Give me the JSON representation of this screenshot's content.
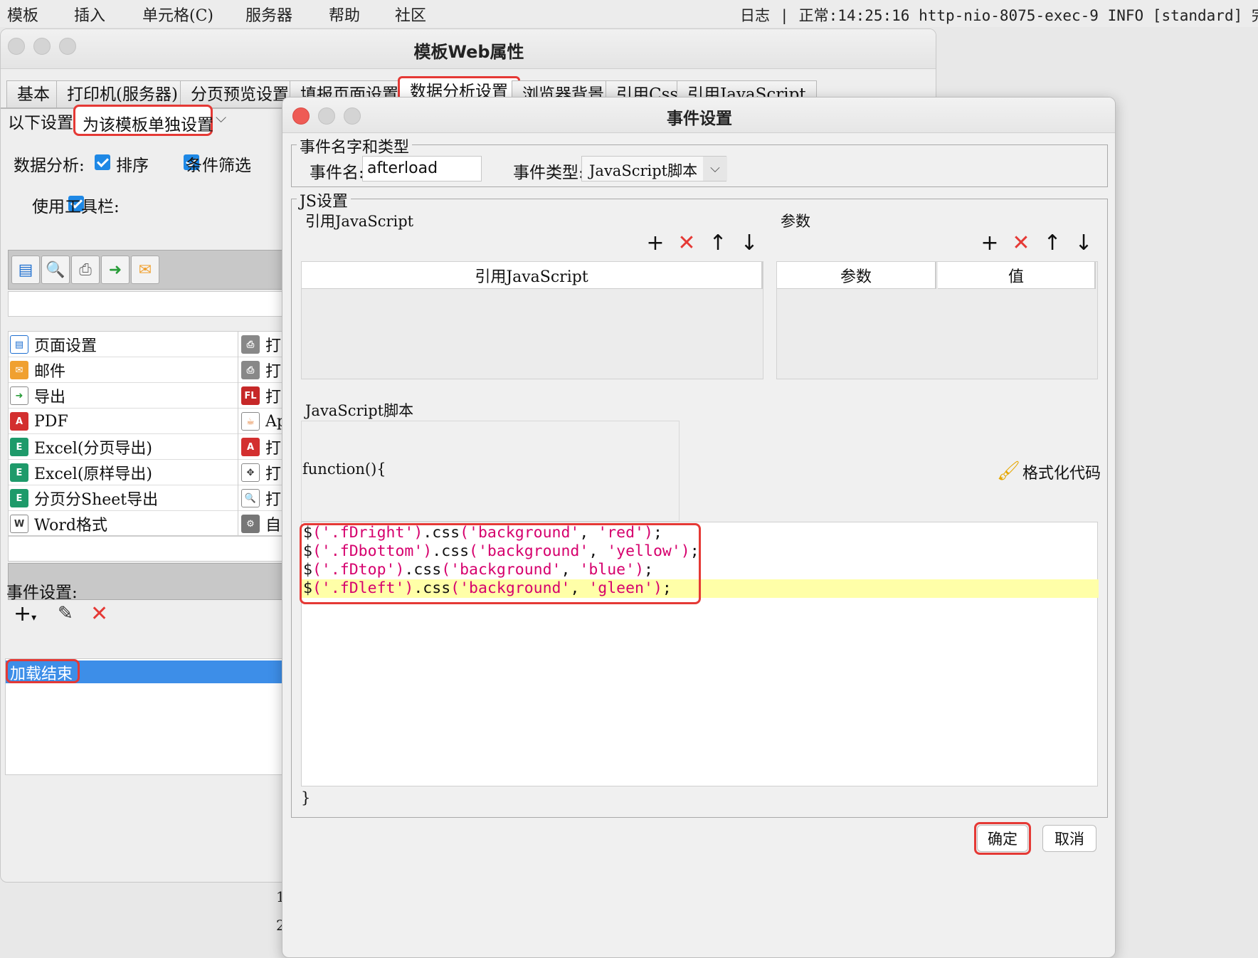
{
  "menubar": {
    "items": [
      "模板",
      "插入",
      "单元格(C)",
      "服务器",
      "帮助",
      "社区"
    ],
    "log_label": "日志",
    "log_text": "正常:14:25:16 http-nio-8075-exec-9 INFO [standard] 完成"
  },
  "background_rows": [
    "1",
    "2"
  ],
  "parent_window": {
    "title": "模板Web属性",
    "tabs": [
      "基本",
      "打印机(服务器)",
      "分页预览设置",
      "填报页面设置",
      "数据分析设置",
      "浏览器背景",
      "引用Css",
      "引用JavaScript"
    ],
    "active_tab": "数据分析设置",
    "settings_label": "以下设置:",
    "settings_value": "为该模板单独设置",
    "analysis_label": "数据分析:",
    "sort_label": "排序",
    "filter_label": "条件筛选",
    "toolbar_label": "使用工具栏:",
    "list_left": [
      "页面设置",
      "邮件",
      "导出",
      "PDF",
      "Excel(分页导出)",
      "Excel(原样导出)",
      "分页分Sheet导出",
      "Word格式"
    ],
    "list_right": [
      "打印",
      "打印",
      "打印",
      "App",
      "打印",
      "打印",
      "打印",
      "自定"
    ],
    "event_label": "事件设置:",
    "event_item": "加载结束"
  },
  "dialog": {
    "title": "事件设置",
    "group_name_type": "事件名字和类型",
    "event_name_label": "事件名:",
    "event_name_value": "afterload",
    "event_type_label": "事件类型:",
    "event_type_value": "JavaScript脚本",
    "js_settings_label": "JS设置",
    "ref_js_label": "引用JavaScript",
    "params_label": "参数",
    "ref_js_col": "引用JavaScript",
    "param_col": "参数",
    "value_col": "值",
    "script_label": "JavaScript脚本",
    "func_open": "function(){",
    "format_code": "格式化代码",
    "func_close": "}",
    "code_lines": [
      {
        "sel": "'.fDright'",
        "arg1": "'background'",
        "arg2": "'red'"
      },
      {
        "sel": "'.fDbottom'",
        "arg1": "'background'",
        "arg2": "'yellow'"
      },
      {
        "sel": "'.fDtop'",
        "arg1": "'background'",
        "arg2": "'blue'"
      },
      {
        "sel": "'.fDleft'",
        "arg1": "'background'",
        "arg2": "'gleen'"
      }
    ],
    "ok": "确定",
    "cancel": "取消"
  },
  "colors": {
    "highlight_red": "#e53935",
    "selection_blue": "#3d8ee8",
    "string_magenta": "#d6006d",
    "line_highlight": "#ffffa8"
  }
}
